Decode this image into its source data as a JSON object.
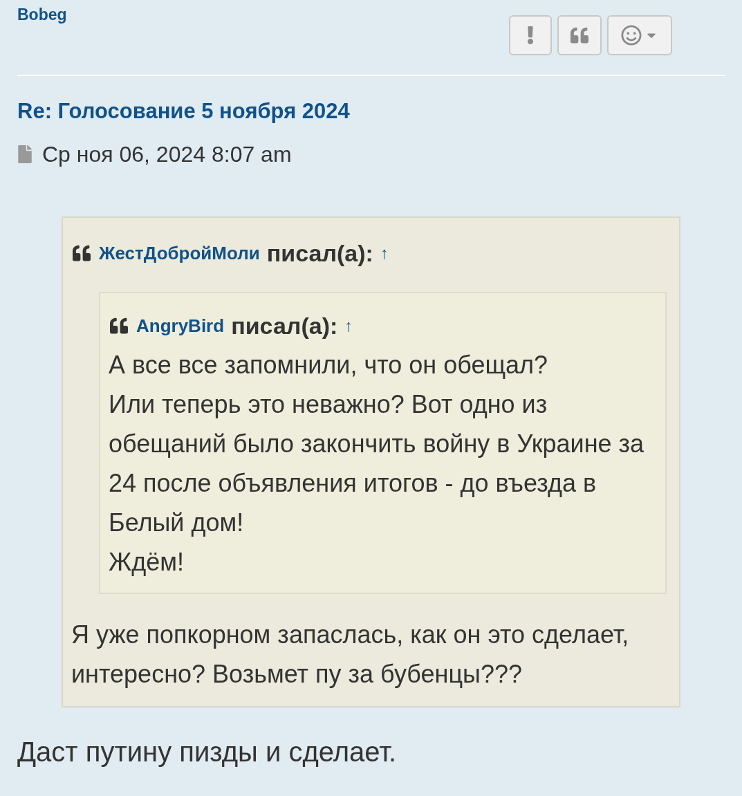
{
  "post": {
    "author": "Bobeg",
    "title": "Re: Голосование 5 ноября 2024",
    "date": "Ср ноя 06, 2024 8:07 am",
    "quote": {
      "author": "ЖестДобройМоли",
      "wrote": "писал(а):",
      "jump": "↑",
      "quote": {
        "author": "AngryBird",
        "wrote": "писал(а):",
        "jump": "↑",
        "paragraphs": [
          "А все все запомнили, что он обещал?",
          "Или теперь это неважно? Вот одно из обещаний было закончить войну в Украине за 24 после объявления итогов - до въезда в Белый дом!",
          "Ждём!"
        ]
      },
      "paragraphs": [
        "Я уже попкорном запаслась, как он это сделает, интересно? Возьмет пу за бубенцы???"
      ]
    },
    "body": "Даст путину пизды и сделает."
  }
}
